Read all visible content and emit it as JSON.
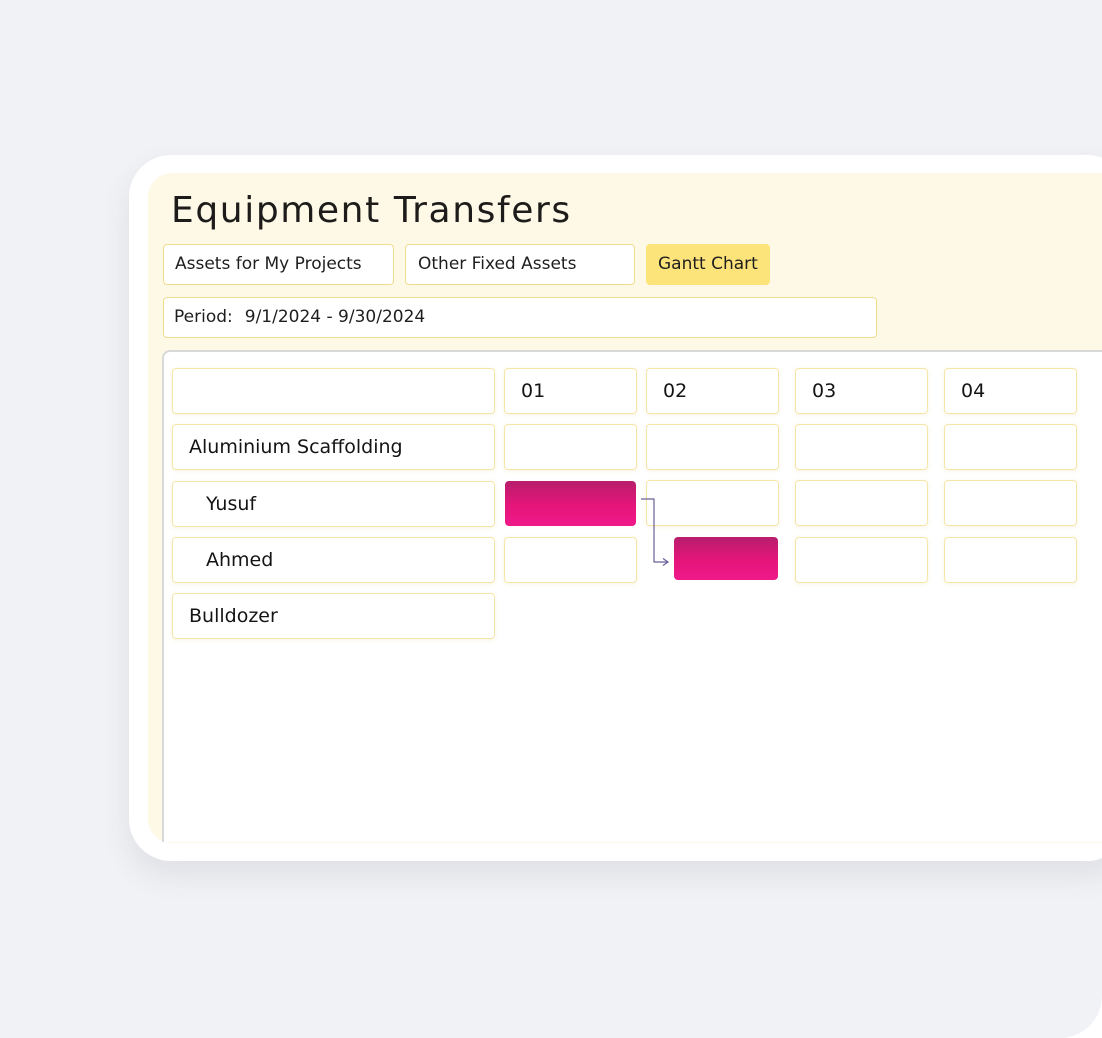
{
  "page_title": "Equipment Transfers",
  "tabs": [
    {
      "label": "Assets for My Projects",
      "active": false
    },
    {
      "label": "Other Fixed Assets",
      "active": false
    },
    {
      "label": "Gantt Chart",
      "active": true
    }
  ],
  "period": {
    "label": "Period:",
    "value": "9/1/2024 - 9/30/2024"
  },
  "gantt": {
    "columns": [
      "01",
      "02",
      "03",
      "04"
    ],
    "rows": [
      {
        "label": "Aluminium Scaffolding",
        "type": "group"
      },
      {
        "label": "Yusuf",
        "type": "assignee",
        "bar_day": "01"
      },
      {
        "label": "Ahmed",
        "type": "assignee",
        "bar_day": "02"
      },
      {
        "label": "Bulldozer",
        "type": "group"
      }
    ],
    "dependency": {
      "from": "Yusuf",
      "to": "Ahmed"
    }
  },
  "colors": {
    "accent": "#fde47a",
    "panel": "#fdf9e6",
    "bar": "#e5157a",
    "border": "#f1dc8c",
    "connector": "#6a5f96"
  }
}
